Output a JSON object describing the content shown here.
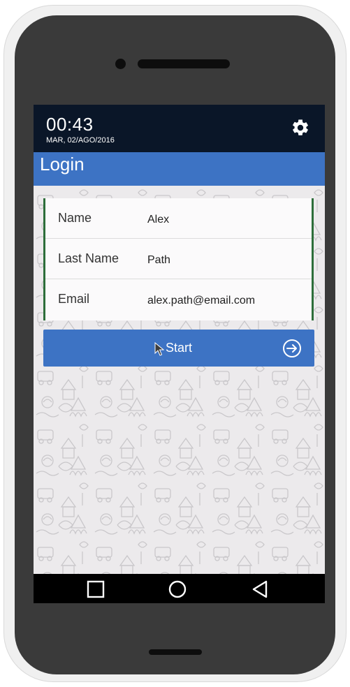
{
  "status_bar": {
    "time": "00:43",
    "date": "MAR, 02/AGO/2016",
    "settings_icon": "gear-icon"
  },
  "header": {
    "title": "Login"
  },
  "form": {
    "fields": [
      {
        "label": "Name",
        "value": "Alex"
      },
      {
        "label": "Last Name",
        "value": "Path"
      },
      {
        "label": "Email",
        "value": "alex.path@email.com"
      }
    ]
  },
  "start_button": {
    "label": "Start",
    "icon": "arrow-circle-right-icon"
  },
  "nav_bar": {
    "buttons": [
      "recents-square-icon",
      "home-circle-icon",
      "back-triangle-icon"
    ]
  },
  "colors": {
    "accent": "#3d73c4",
    "status_bar_bg": "#0a1628",
    "field_border": "#2d6e3a",
    "phone_body": "#3a3a3a"
  }
}
